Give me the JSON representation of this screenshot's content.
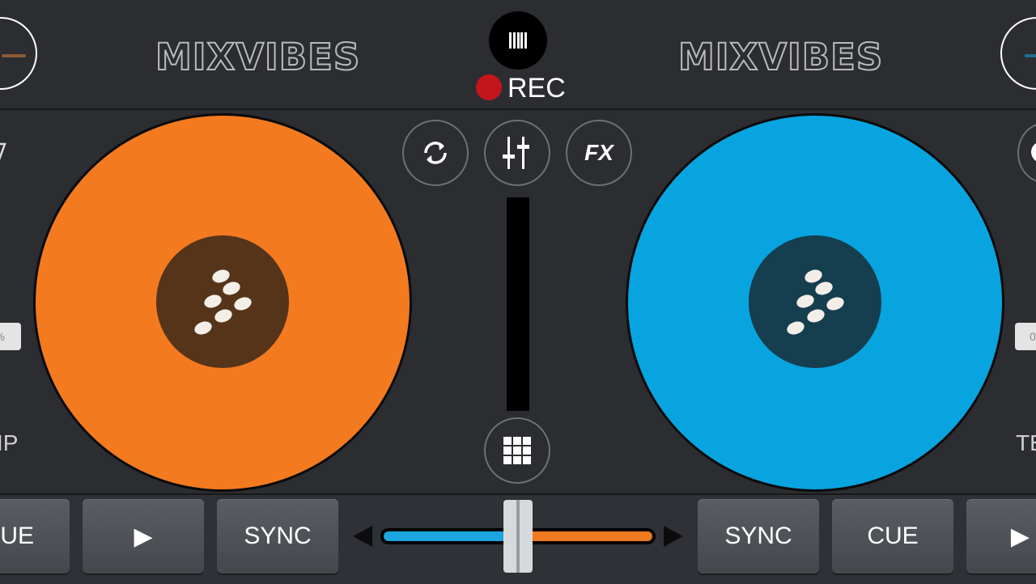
{
  "header": {
    "left_logo": "MIXVIBES",
    "right_logo": "MIXVIBES",
    "rec_label": "REC"
  },
  "center": {
    "fx_label": "FX"
  },
  "side": {
    "left_pill": "%",
    "left_text": "IP",
    "right_pill": "0",
    "right_text": "TE"
  },
  "bottom": {
    "left_cue": "CUE",
    "left_play": "▶",
    "left_sync": "SYNC",
    "right_sync": "SYNC",
    "right_cue": "CUE",
    "right_play": "▶"
  },
  "colors": {
    "deck_a": "#f47a1f",
    "deck_a_label": "#55341a",
    "deck_b": "#08a4df",
    "deck_b_label": "#153e4f",
    "rec": "#c4151c"
  },
  "icons": {
    "loop": "loop-icon",
    "mixer": "mixer-sliders-icon",
    "grid": "sampler-grid-icon",
    "rec": "record-icon"
  }
}
